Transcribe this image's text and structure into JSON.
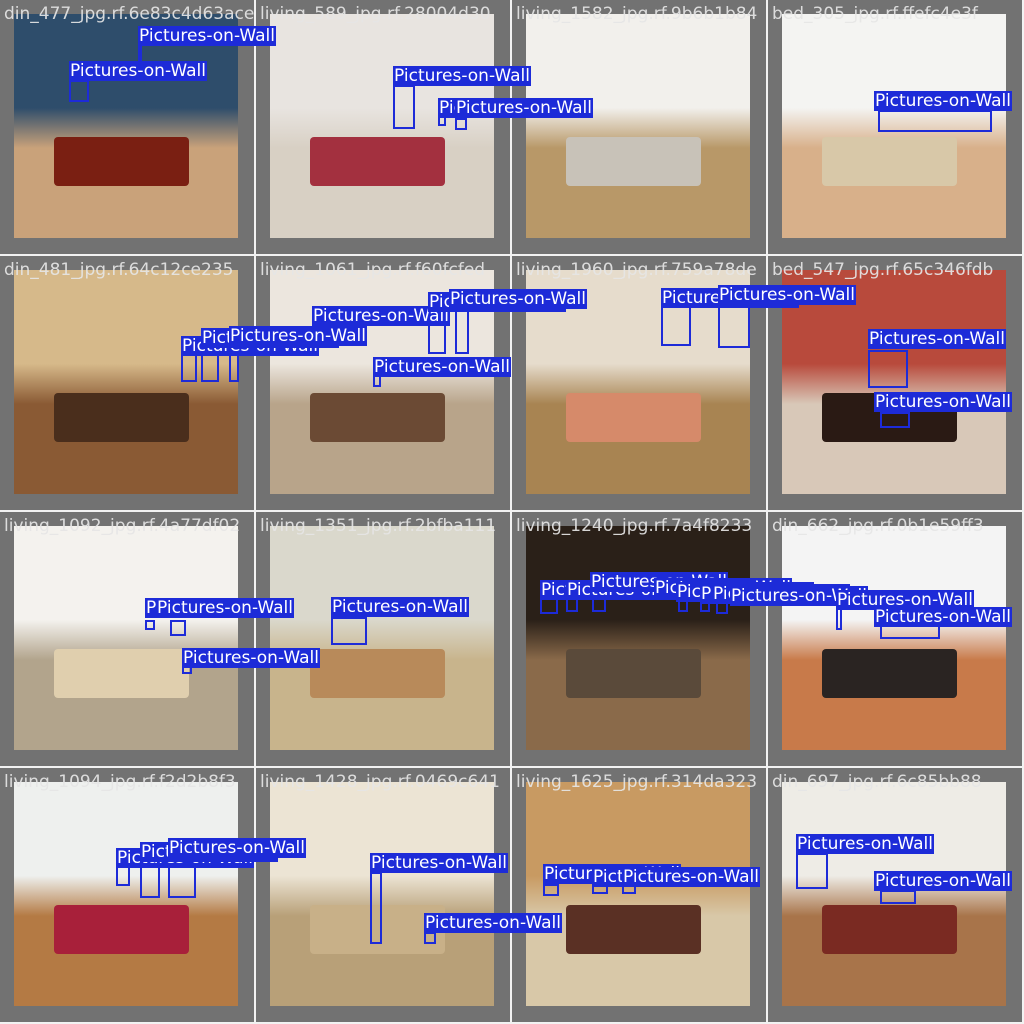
{
  "detection_class": "Pictures-on-Wall",
  "colors": {
    "box": "#1d2bd8",
    "label_text": "#ffffff",
    "tile_bg": "#727272",
    "filename_text": "#e6e6e6"
  },
  "tiles": [
    {
      "filename": "din_477_jpg.rf.6e83c4d63ace",
      "scene": "dining",
      "palette": [
        "#2e4d6b",
        "#7a1f12",
        "#c9a27a"
      ]
    },
    {
      "filename": "living_589_jpg.rf.28004d30",
      "scene": "living",
      "palette": [
        "#e8e4e0",
        "#a3303f",
        "#d8d0c4"
      ]
    },
    {
      "filename": "living_1582_jpg.rf.9b6b1b84",
      "scene": "living",
      "palette": [
        "#f2f0ec",
        "#c8c2b8",
        "#b89868"
      ]
    },
    {
      "filename": "bed_305_jpg.rf.ffefc4e3f",
      "scene": "bedroom",
      "palette": [
        "#f4f4f2",
        "#d8c8a8",
        "#d8b08a"
      ]
    },
    {
      "filename": "din_481_jpg.rf.64c12ce235",
      "scene": "dining",
      "palette": [
        "#d6b98a",
        "#4a2e1c",
        "#8a5a34"
      ]
    },
    {
      "filename": "living_1061_jpg.rf.f60fcfed",
      "scene": "living",
      "palette": [
        "#ece6de",
        "#6b4a34",
        "#b8a48a"
      ]
    },
    {
      "filename": "living_1960_jpg.rf.759a78de",
      "scene": "living",
      "palette": [
        "#e6dccc",
        "#d68a6a",
        "#a88452"
      ]
    },
    {
      "filename": "bed_547_jpg.rf.65c346fdb",
      "scene": "bedroom",
      "palette": [
        "#b84a3c",
        "#2a1a14",
        "#d8c8b8"
      ]
    },
    {
      "filename": "living_1092_jpg.rf.4a77df02",
      "scene": "living",
      "palette": [
        "#f4f2ee",
        "#e0cfae",
        "#b2a48c"
      ]
    },
    {
      "filename": "living_1351_jpg.rf.2bfba111",
      "scene": "living",
      "palette": [
        "#dad8cc",
        "#b88a5a",
        "#c8b48c"
      ]
    },
    {
      "filename": "living_1240_jpg.rf.7a4f8233",
      "scene": "living",
      "palette": [
        "#2a2018",
        "#5a4a3a",
        "#8a6a4a"
      ]
    },
    {
      "filename": "din_662_jpg.rf.0b1e59ff3",
      "scene": "dining",
      "palette": [
        "#f4f4f4",
        "#2a2422",
        "#c87a4a"
      ]
    },
    {
      "filename": "living_1094_jpg.rf.f2d2b8f3",
      "scene": "living",
      "palette": [
        "#eef0ee",
        "#a8203a",
        "#b47a44"
      ]
    },
    {
      "filename": "living_1428_jpg.rf.0469c641",
      "scene": "living",
      "palette": [
        "#ece4d4",
        "#c8b088",
        "#b8a078"
      ]
    },
    {
      "filename": "living_1625_jpg.rf.314da323",
      "scene": "living",
      "palette": [
        "#c89a62",
        "#5a3024",
        "#d8c8a8"
      ]
    },
    {
      "filename": "din_697_jpg.rf.6c85bb88",
      "scene": "dining",
      "palette": [
        "#eeece6",
        "#7a2a22",
        "#a8744a"
      ]
    }
  ]
}
